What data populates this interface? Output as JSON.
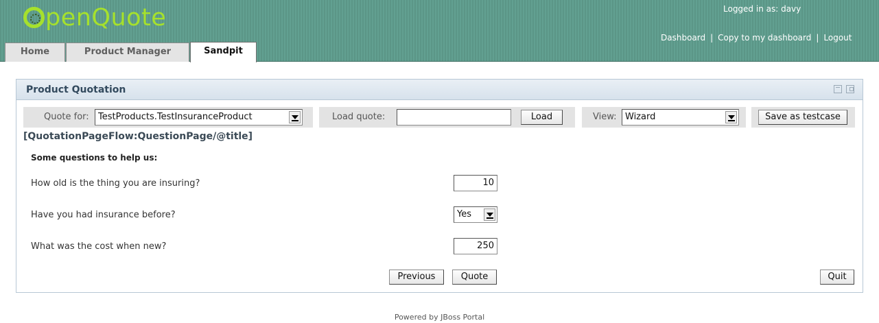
{
  "header": {
    "logo_text": "penQuote",
    "logged_in_text": "Logged in as: davy",
    "links": [
      "Dashboard",
      "Copy to my dashboard",
      "Logout"
    ],
    "separator": "|",
    "accent_color": "#a6e12c"
  },
  "tabs": [
    {
      "label": "Home",
      "selected": false
    },
    {
      "label": "Product Manager",
      "selected": false
    },
    {
      "label": "Sandpit",
      "selected": true
    }
  ],
  "portlet": {
    "title": "Product Quotation",
    "icons": [
      "minimize-icon",
      "maximize-icon"
    ]
  },
  "toolbar": {
    "quote_for_label": "Quote for:",
    "quote_for_value": "TestProducts.TestInsuranceProduct",
    "load_quote_label": "Load quote:",
    "load_quote_value": "",
    "load_button": "Load",
    "view_label": "View:",
    "view_value": "Wizard",
    "save_testcase_button": "Save as testcase"
  },
  "page": {
    "heading": "[QuotationPageFlow:QuestionPage/@title]",
    "subheading": "Some questions to help us:"
  },
  "questions": [
    {
      "label": "How old is the thing you are insuring?",
      "value": "10"
    },
    {
      "label": "Have you had insurance before?",
      "value": "Yes"
    },
    {
      "label": "What was the cost when new?",
      "value": "250"
    }
  ],
  "actions": {
    "previous": "Previous",
    "quote": "Quote",
    "quit": "Quit"
  },
  "footer": "Powered by JBoss Portal"
}
